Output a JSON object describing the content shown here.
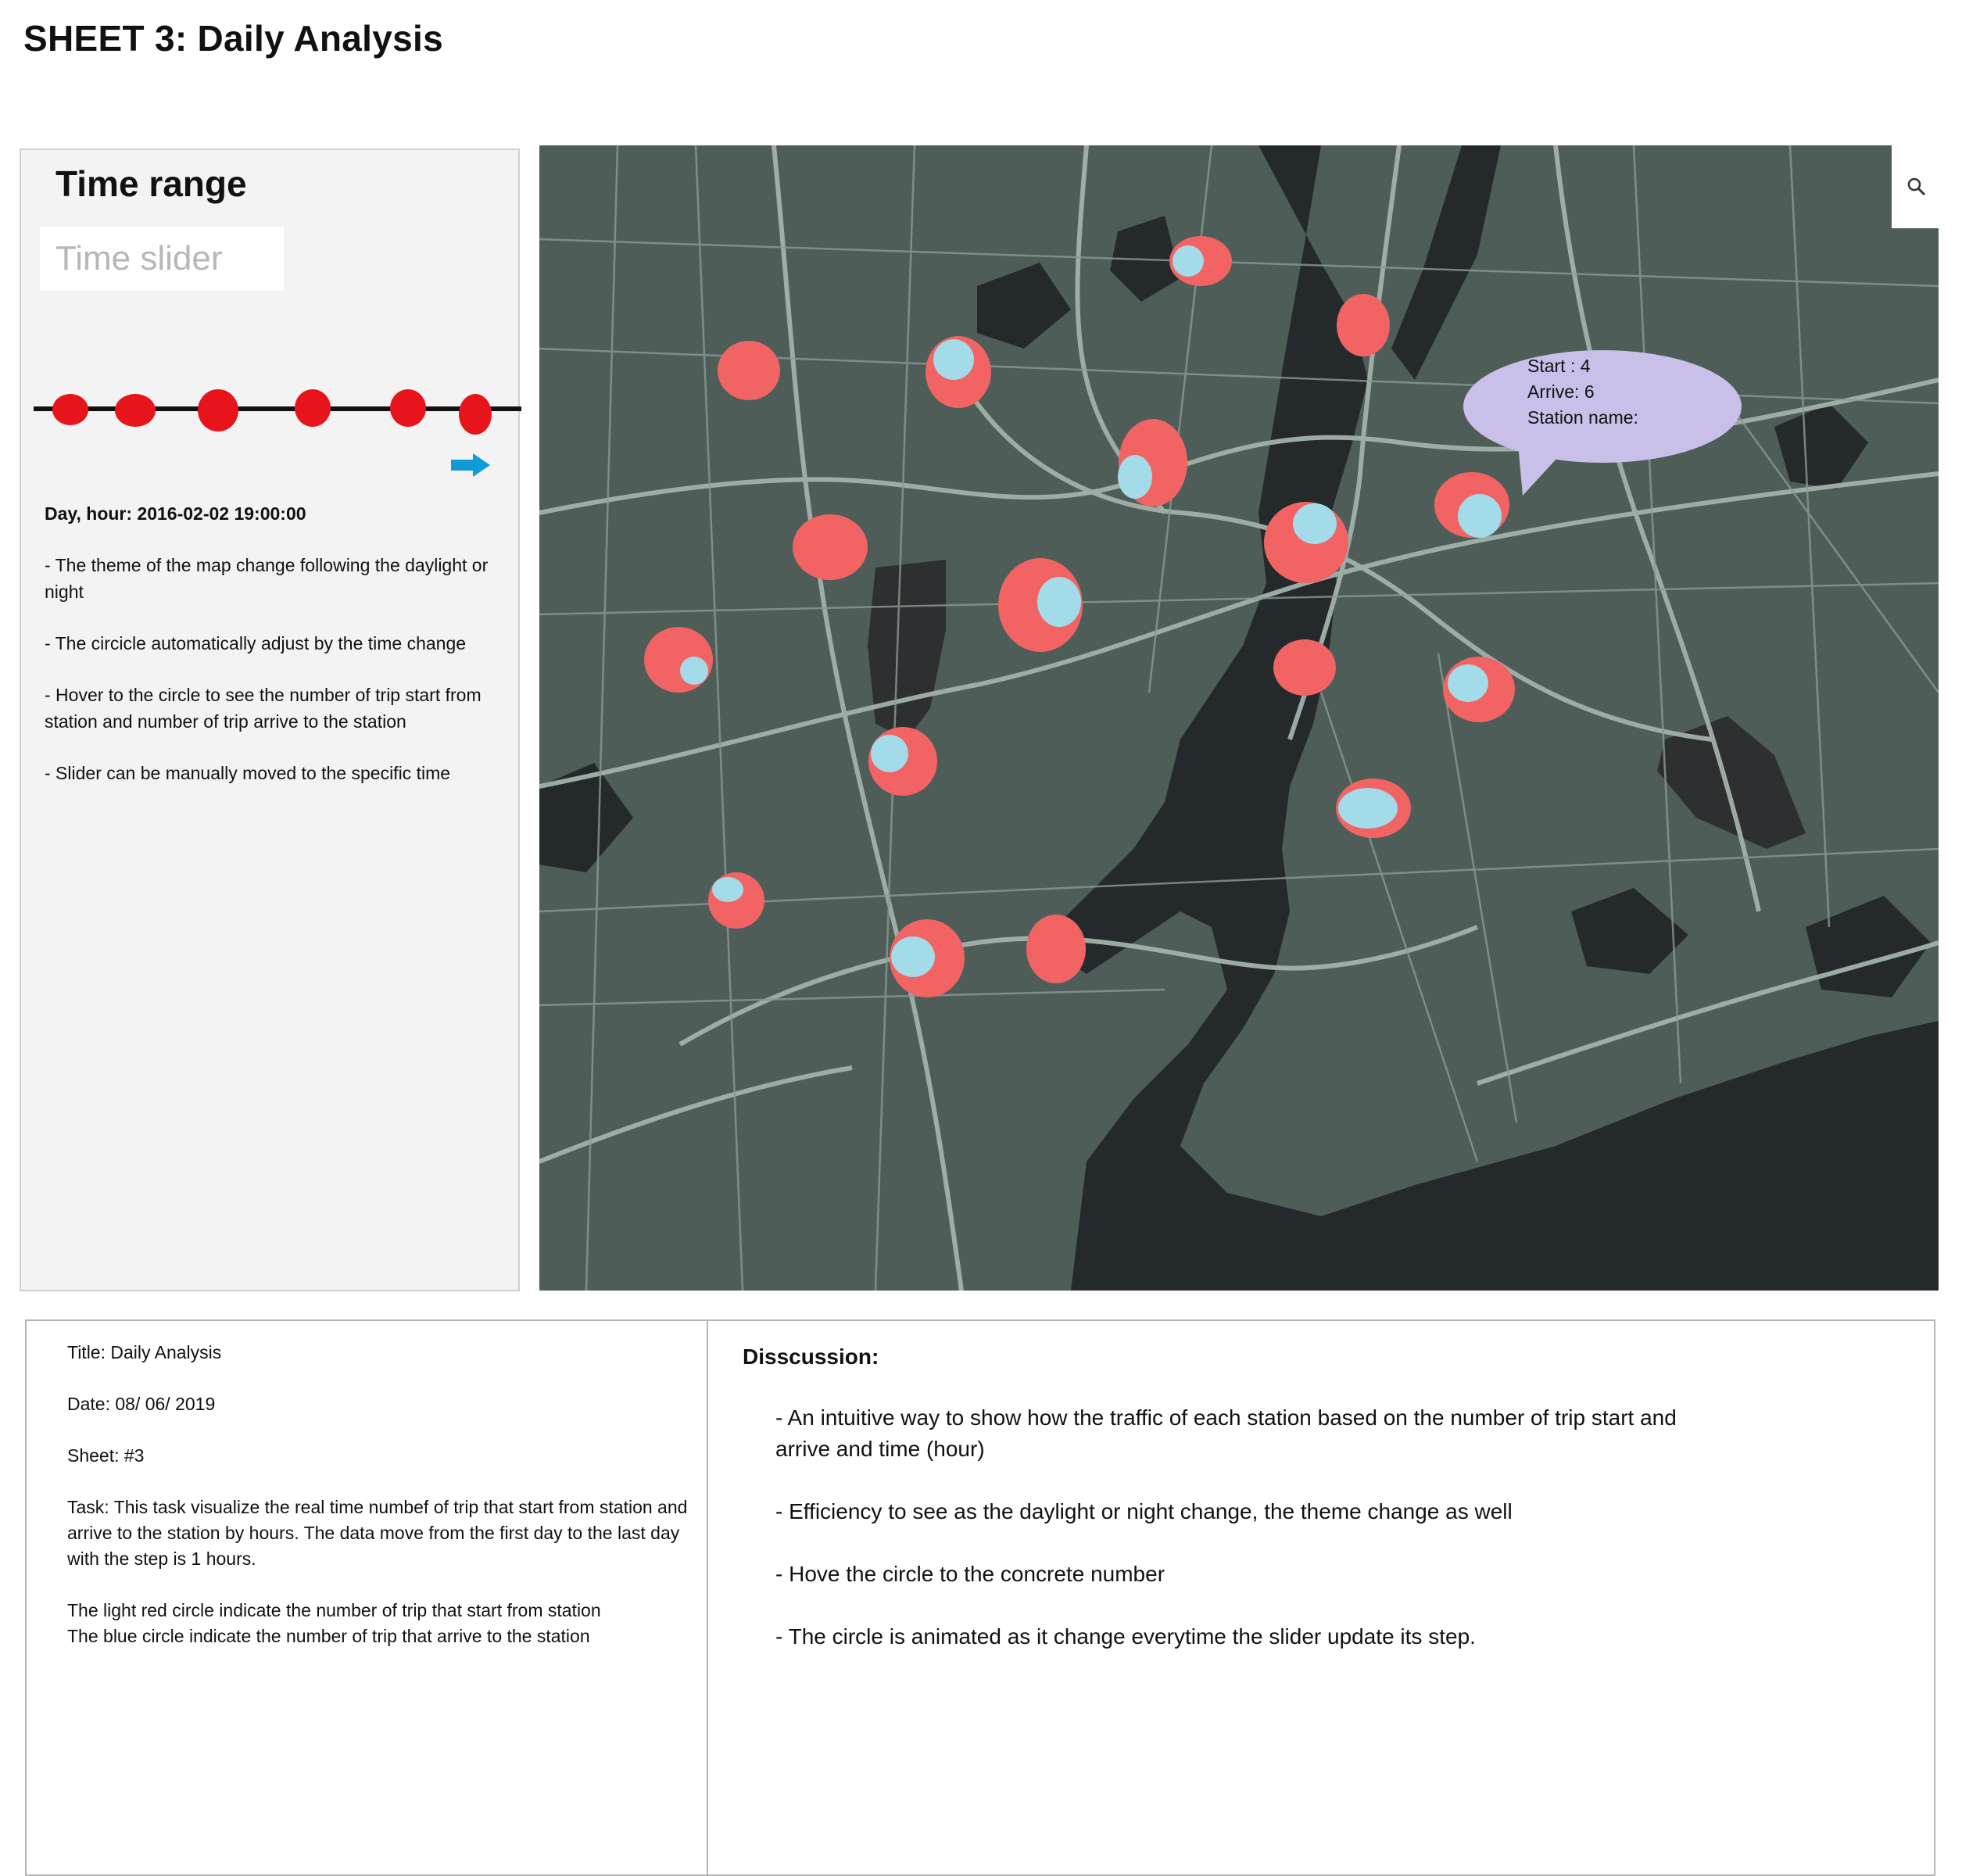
{
  "page": {
    "title": "SHEET 3: Daily Analysis"
  },
  "left_panel": {
    "heading": "Time range",
    "slider_placeholder": "Time slider",
    "day_hour": "Day, hour: 2016-02-02 19:00:00",
    "notes": [
      "- The theme of the map change following the daylight or night",
      "- The circicle automatically adjust by the time change",
      "- Hover to the circle to see the number of trip start from station and number of trip arrive to the station",
      "- Slider can be manually moved to the specific time"
    ],
    "colors": {
      "slider_dot": "#e8141c",
      "arrow": "#0e9bd8"
    }
  },
  "map": {
    "tooltip": {
      "start": "Start : 4",
      "arrive": "Arrive: 6",
      "station_name": "Station name:"
    },
    "colors": {
      "land": "#4e5d58",
      "water": "#242a2c",
      "roads": "#a3b1ab",
      "start_circle": "#f26464",
      "arrive_circle": "#a3dbe9",
      "tooltip_bg": "#c8c0e8"
    },
    "zoom_icon": "search-icon"
  },
  "bottom": {
    "meta": {
      "title": "Title: Daily Analysis",
      "date": "Date: 08/ 06/ 2019",
      "sheet": "Sheet: #3",
      "task": "Task: This task visualize the real time numbef of trip that start from station and arrive to the station by hours. The data move from the first day to the last day with the step is 1 hours.",
      "legend_start": "The light red circle indicate the number of trip that start from station",
      "legend_arrive": "The blue circle indicate the number of trip that arrive to the station"
    },
    "discussion": {
      "title": "Disscussion:",
      "points": [
        "- An intuitive way to show how the traffic of each station based on the number of trip start and arrive and time (hour)",
        "- Efficiency to see as the daylight or night change, the theme change as well",
        "- Hove the circle to the concrete number",
        "- The circle is animated as it change everytime the slider update its step."
      ]
    }
  }
}
